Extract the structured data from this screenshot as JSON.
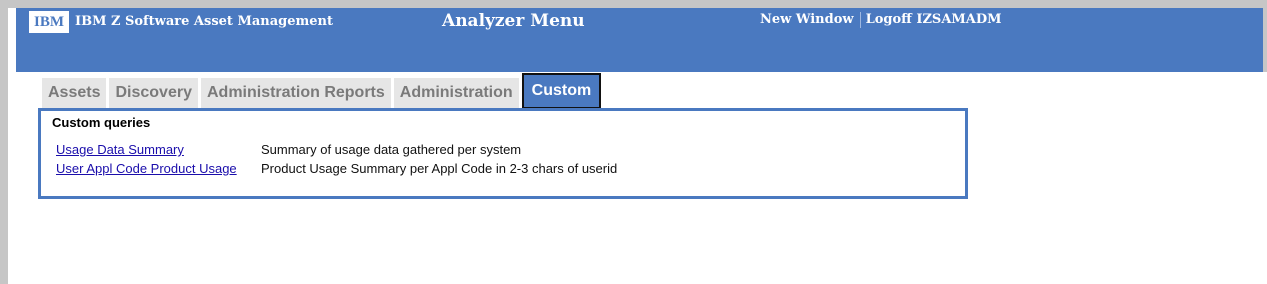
{
  "header": {
    "logo_text": "IBM",
    "product_name": "IBM Z Software Asset Management",
    "page_title": "Analyzer Menu",
    "links": [
      {
        "label": "New Window"
      },
      {
        "label": "Logoff IZSAMADM"
      }
    ]
  },
  "tabs": [
    {
      "label": "Assets",
      "active": false
    },
    {
      "label": "Discovery",
      "active": false
    },
    {
      "label": "Administration Reports",
      "active": false
    },
    {
      "label": "Administration",
      "active": false
    },
    {
      "label": "Custom",
      "active": true
    }
  ],
  "content": {
    "section_title": "Custom queries",
    "queries": [
      {
        "link": "Usage Data Summary",
        "description": "Summary of usage data gathered per system"
      },
      {
        "link": "User Appl Code Product Usage",
        "description": "Product Usage Summary per Appl Code in 2-3 chars of userid"
      }
    ]
  },
  "colors": {
    "header_bg": "#4a79c0",
    "tab_inactive_bg": "#e6e6e6",
    "tab_inactive_text": "#7a7a7a",
    "link": "#1a0dab"
  }
}
